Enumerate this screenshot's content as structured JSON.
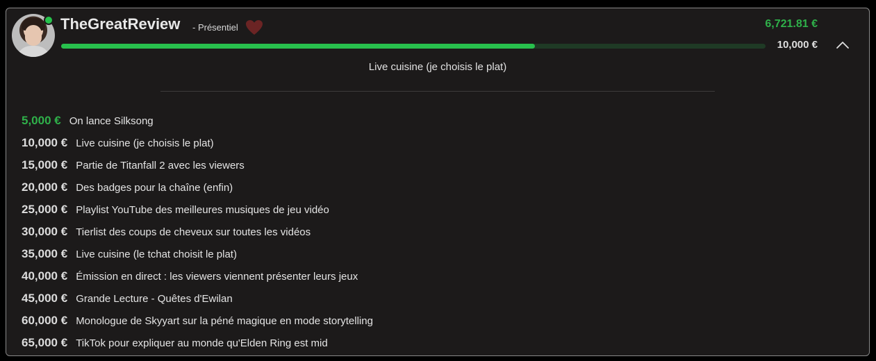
{
  "streamer": {
    "name": "TheGreatReview",
    "subtitle": "- Présentiel",
    "online": true
  },
  "progress": {
    "current": "6,721.81 €",
    "goal": "10,000 €",
    "fraction": 0.6722,
    "next_goal_label": "Live cuisine (je choisis le plat)"
  },
  "colors": {
    "accent_green": "#2fb14a",
    "bar_fill": "#28c04d",
    "bar_track": "#1f3a25",
    "heart": "#6b2424"
  },
  "icons": {
    "heart": "heart-icon",
    "collapse": "chevron-up-icon"
  },
  "goals": [
    {
      "amount": "5,000 €",
      "text": "On lance Silksong",
      "reached": true
    },
    {
      "amount": "10,000 €",
      "text": "Live cuisine (je choisis le plat)",
      "reached": false
    },
    {
      "amount": "15,000 €",
      "text": "Partie de Titanfall 2 avec les viewers",
      "reached": false
    },
    {
      "amount": "20,000 €",
      "text": "Des badges pour la chaîne (enfin)",
      "reached": false
    },
    {
      "amount": "25,000 €",
      "text": "Playlist YouTube des meilleures musiques de jeu vidéo",
      "reached": false
    },
    {
      "amount": "30,000 €",
      "text": "Tierlist des coups de cheveux sur toutes les vidéos",
      "reached": false
    },
    {
      "amount": "35,000 €",
      "text": "Live cuisine (le tchat choisit le plat)",
      "reached": false
    },
    {
      "amount": "40,000 €",
      "text": "Émission en direct : les viewers viennent présenter leurs jeux",
      "reached": false
    },
    {
      "amount": "45,000 €",
      "text": "Grande Lecture - Quêtes d'Ewilan",
      "reached": false
    },
    {
      "amount": "60,000 €",
      "text": "Monologue de Skyyart sur la péné magique en mode storytelling",
      "reached": false
    },
    {
      "amount": "65,000 €",
      "text": "TikTok pour expliquer au monde qu'Elden Ring est mid",
      "reached": false
    }
  ]
}
